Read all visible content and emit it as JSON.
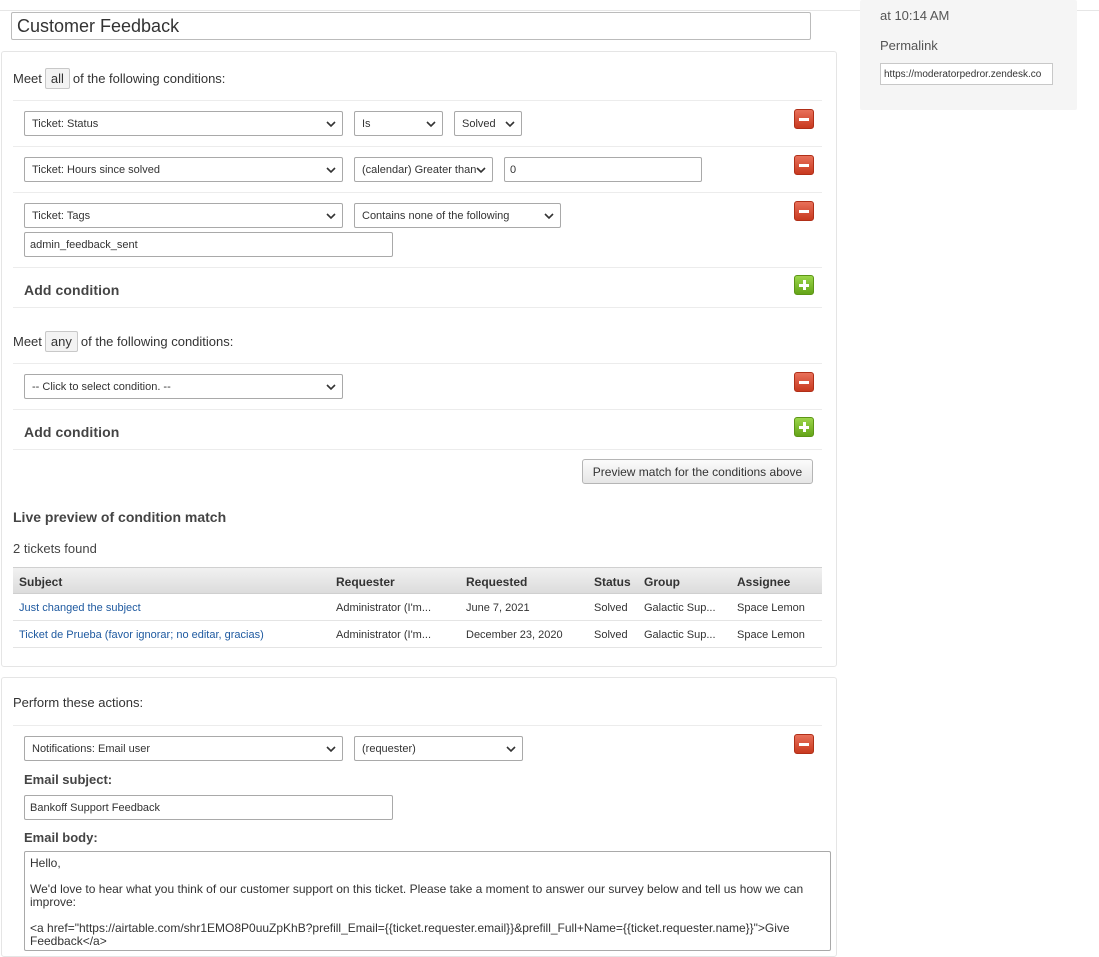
{
  "header": {
    "title_value": "Customer Feedback"
  },
  "sidebar": {
    "time": "at 10:14 AM",
    "permalink_label": "Permalink",
    "permalink_value": "https://moderatorpedror.zendesk.co"
  },
  "conditions_all": {
    "meet_prefix": "Meet",
    "meet_value": "all",
    "meet_suffix": "of the following conditions:",
    "rows": [
      {
        "field": "Ticket: Status",
        "operator": "Is",
        "value": "Solved"
      },
      {
        "field": "Ticket: Hours since solved",
        "operator": "(calendar) Greater than",
        "value": "0"
      },
      {
        "field": "Ticket: Tags",
        "operator": "Contains none of the following",
        "value": "admin_feedback_sent"
      }
    ],
    "add_label": "Add condition"
  },
  "conditions_any": {
    "meet_prefix": "Meet",
    "meet_value": "any",
    "meet_suffix": "of the following conditions:",
    "rows": [
      {
        "field": "-- Click to select condition. --"
      }
    ],
    "add_label": "Add condition"
  },
  "preview": {
    "button_label": "Preview match for the conditions above",
    "heading": "Live preview of condition match",
    "count_text": "2 tickets found",
    "columns": [
      "Subject",
      "Requester",
      "Requested",
      "Status",
      "Group",
      "Assignee"
    ],
    "rows": [
      [
        "Just changed the subject",
        "Administrator (I'm...",
        "June 7, 2021",
        "Solved",
        "Galactic Sup...",
        "Space Lemon"
      ],
      [
        "Ticket de Prueba (favor ignorar; no editar, gracias)",
        "Administrator (I'm...",
        "December 23, 2020",
        "Solved",
        "Galactic Sup...",
        "Space Lemon"
      ]
    ]
  },
  "actions": {
    "heading": "Perform these actions:",
    "action_field": "Notifications: Email user",
    "action_target": "(requester)",
    "subject_label": "Email subject:",
    "subject_value": "Bankoff Support Feedback",
    "body_label": "Email body:",
    "body_lines": [
      "Hello,",
      "We'd love to hear what you think of our customer support on this ticket. Please take a moment to answer our survey below and tell us how we can improve:",
      "<a href=\"https://airtable.com/shr1EMO8P0uuZpKhB?prefill_Email={{ticket.requester.email}}&prefill_Full+Name={{ticket.requester.name}}\">Give Feedback</a>"
    ]
  },
  "colors": {
    "remove_button": "#d9482b",
    "add_button": "#7cbf2b",
    "link": "#1f5aa0"
  }
}
